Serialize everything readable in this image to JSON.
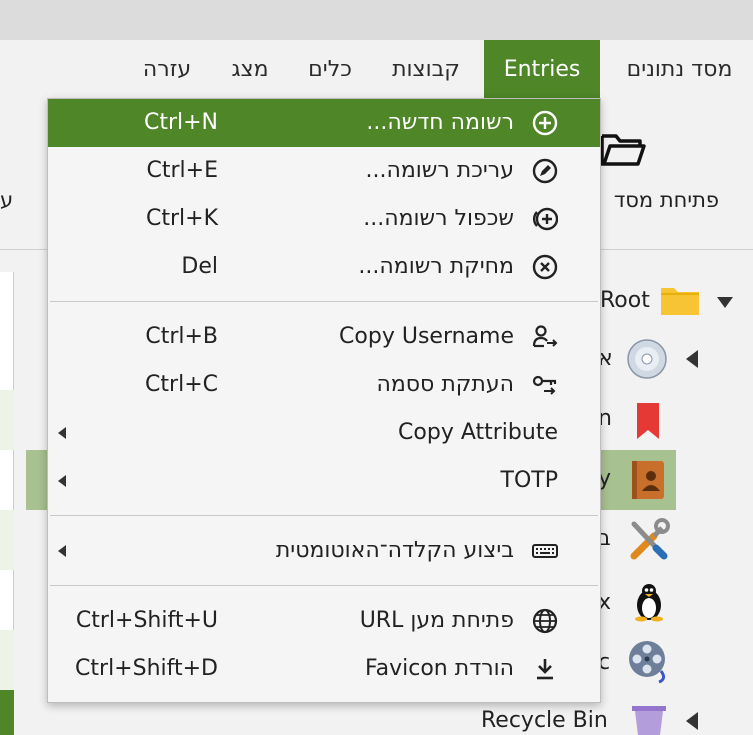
{
  "menubar": {
    "items": [
      {
        "label": "מסד נתונים"
      },
      {
        "label": "Entries",
        "active": true
      },
      {
        "label": "קבוצות"
      },
      {
        "label": "כלים"
      },
      {
        "label": "מצג"
      },
      {
        "label": "עזרה"
      }
    ]
  },
  "toolbar": {
    "open_database_label": "פתיחת מסד",
    "left_cut_label": "ע"
  },
  "tree": {
    "root_label": "Root",
    "rows": [
      {
        "label_fragment": "א",
        "icon": "cd-icon"
      },
      {
        "label_fragment": "n",
        "icon": "bookmark-icon"
      },
      {
        "label_fragment": "y",
        "icon": "contact-book-icon"
      },
      {
        "label_fragment": "ב",
        "icon": "tools-icon"
      },
      {
        "label_fragment": "x",
        "icon": "linux-icon"
      },
      {
        "label_fragment": "c",
        "icon": "film-reel-icon"
      }
    ],
    "recycle_bin_label": "Recycle Bin"
  },
  "entries_menu": {
    "items": [
      {
        "label": "רשומה חדשה...",
        "shortcut": "Ctrl+N",
        "icon": "add-circle-icon",
        "highlighted": true
      },
      {
        "label": "עריכת רשומה...",
        "shortcut": "Ctrl+E",
        "icon": "edit-circle-icon"
      },
      {
        "label": "שכפול רשומה...",
        "shortcut": "Ctrl+K",
        "icon": "clone-icon"
      },
      {
        "label": "מחיקת רשומה...",
        "shortcut": "Del",
        "icon": "delete-circle-icon"
      },
      {
        "label": "Copy Username",
        "shortcut": "Ctrl+B",
        "icon": "user-copy-icon"
      },
      {
        "label": "העתקת ססמה",
        "shortcut": "Ctrl+C",
        "icon": "key-copy-icon"
      },
      {
        "label": "Copy Attribute",
        "has_submenu": true
      },
      {
        "label": "TOTP",
        "has_submenu": true
      },
      {
        "label": "ביצוע הקלדה־האוטומטית",
        "icon": "keyboard-icon",
        "has_submenu": true
      },
      {
        "label": "פתיחת מען URL",
        "shortcut": "Ctrl+Shift+U",
        "icon": "globe-icon"
      },
      {
        "label": "הורדת Favicon",
        "shortcut": "Ctrl+Shift+D",
        "icon": "download-icon"
      }
    ]
  },
  "colors": {
    "accent": "#4e8628",
    "selected_row": "#a8c190",
    "folder_yellow": "#f7c533",
    "bookmark_red": "#e53935",
    "recycle_purple": "#b39ddb"
  }
}
